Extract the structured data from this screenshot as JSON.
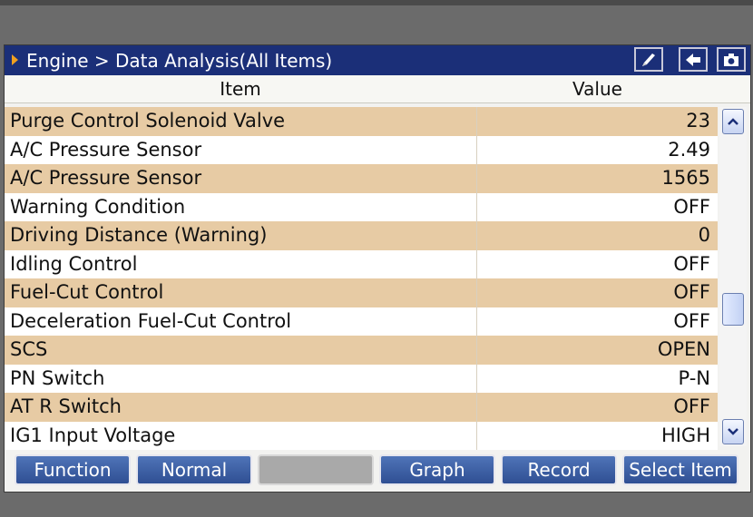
{
  "title": {
    "breadcrumb": "Engine > Data Analysis(All Items)"
  },
  "toolbar": {
    "icons": [
      "pencil-icon",
      "back-arrow-icon",
      "camera-icon"
    ]
  },
  "columns": {
    "item": "Item",
    "value": "Value"
  },
  "rows": [
    {
      "item": "Purge Control Solenoid Valve",
      "value": "23"
    },
    {
      "item": "A/C Pressure Sensor",
      "value": "2.49"
    },
    {
      "item": "A/C Pressure Sensor",
      "value": "1565"
    },
    {
      "item": "Warning Condition",
      "value": "OFF"
    },
    {
      "item": "Driving Distance (Warning)",
      "value": "0"
    },
    {
      "item": "Idling Control",
      "value": "OFF"
    },
    {
      "item": "Fuel-Cut Control",
      "value": "OFF"
    },
    {
      "item": "Deceleration Fuel-Cut Control",
      "value": "OFF"
    },
    {
      "item": "SCS",
      "value": "OPEN"
    },
    {
      "item": "PN Switch",
      "value": "P-N"
    },
    {
      "item": "AT R Switch",
      "value": "OFF"
    },
    {
      "item": "IG1 Input Voltage",
      "value": "HIGH"
    }
  ],
  "buttons": {
    "function": "Function",
    "normal": "Normal",
    "empty": "",
    "graph": "Graph",
    "record": "Record",
    "select_item": "Select Item"
  },
  "colors": {
    "titlebar": "#1b2f78",
    "row_alt": "#e7cba4",
    "button": "#3d5fa6"
  }
}
